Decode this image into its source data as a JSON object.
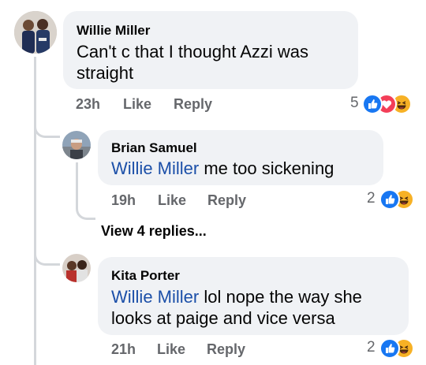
{
  "comments": [
    {
      "author": "Willie Miller",
      "text": "Can't c that I thought Azzi was straight",
      "time": "23h",
      "like_label": "Like",
      "reply_label": "Reply",
      "reaction_count": "5",
      "reactions": [
        "like-icon",
        "love-icon",
        "haha-icon"
      ]
    },
    {
      "author": "Brian Samuel",
      "mention": "Willie Miller",
      "text": " me too sickening",
      "time": "19h",
      "like_label": "Like",
      "reply_label": "Reply",
      "reaction_count": "2",
      "reactions": [
        "like-icon",
        "haha-icon"
      ]
    },
    {
      "author": "Kita Porter",
      "mention": "Willie Miller",
      "text": " lol nope the way she looks at paige and vice versa",
      "time": "21h",
      "like_label": "Like",
      "reply_label": "Reply",
      "reaction_count": "2",
      "reactions": [
        "like-icon",
        "haha-icon"
      ]
    }
  ],
  "view_replies_label": "View 4 replies...",
  "colors": {
    "bubble": "#f0f2f5",
    "like": "#1877f2",
    "love": "#f33e58",
    "haha": "#f7b125",
    "mention": "#1b4fa8"
  }
}
